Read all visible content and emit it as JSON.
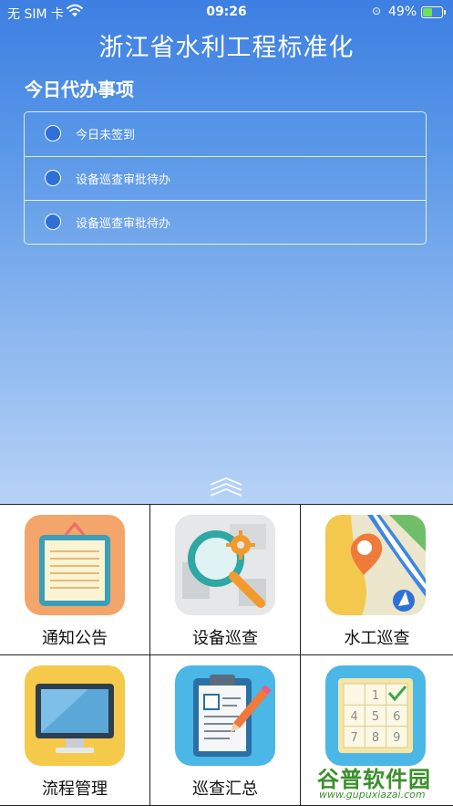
{
  "status_bar": {
    "carrier": "无 SIM 卡",
    "time": "09:26",
    "battery_percent": "49%",
    "battery_level": 0.49,
    "battery_color": "#6fe05a"
  },
  "app": {
    "title": "浙江省水利工程标准化"
  },
  "todo": {
    "title": "今日代办事项",
    "items": [
      {
        "label": "今日未签到"
      },
      {
        "label": "设备巡查审批待办"
      },
      {
        "label": "设备巡查审批待办"
      }
    ]
  },
  "menu": {
    "items": [
      {
        "label": "通知公告",
        "icon": "notice-board-icon"
      },
      {
        "label": "设备巡查",
        "icon": "magnifier-gear-icon"
      },
      {
        "label": "水工巡查",
        "icon": "map-pin-icon"
      },
      {
        "label": "流程管理",
        "icon": "monitor-icon"
      },
      {
        "label": "巡查汇总",
        "icon": "clipboard-pencil-icon"
      },
      {
        "label": "",
        "icon": "number-grid-icon"
      }
    ],
    "grid_digits": [
      "1",
      "4",
      "5",
      "6",
      "7",
      "8",
      "9"
    ]
  },
  "watermark": {
    "title": "谷普软件园",
    "url": "www.gupuxiazai.com"
  },
  "colors": {
    "accent_blue": "#3d7fe2",
    "radio_fill": "#2f6fd8"
  }
}
